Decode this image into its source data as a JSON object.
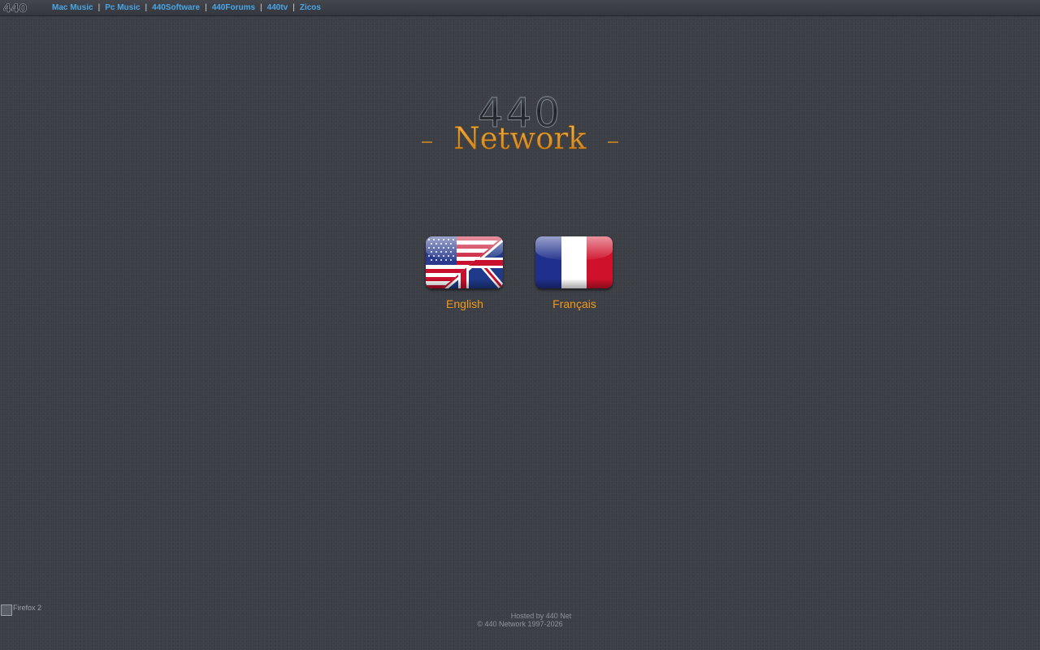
{
  "topnav": {
    "logo_text": "440",
    "links": [
      "Mac Music",
      "Pc Music",
      "440Software",
      "440Forums",
      "440tv",
      "Zicos"
    ],
    "separator": "|"
  },
  "logo": {
    "top_text": "440",
    "bottom_text": "Network"
  },
  "languages": {
    "english": {
      "label": "English",
      "flag": "us-uk-flag-icon"
    },
    "french": {
      "label": "Français",
      "flag": "france-flag-icon"
    }
  },
  "firefox_badge": {
    "alt_text": "Firefox 2"
  },
  "footer": {
    "hosted": "Hosted by 440 Net",
    "copyright": "© 440 Network 1997-2026"
  },
  "colors": {
    "background": "#3c3f46",
    "link": "#4aa6e6",
    "accent_orange": "#f19a1a",
    "footer_text": "#8e949c"
  }
}
